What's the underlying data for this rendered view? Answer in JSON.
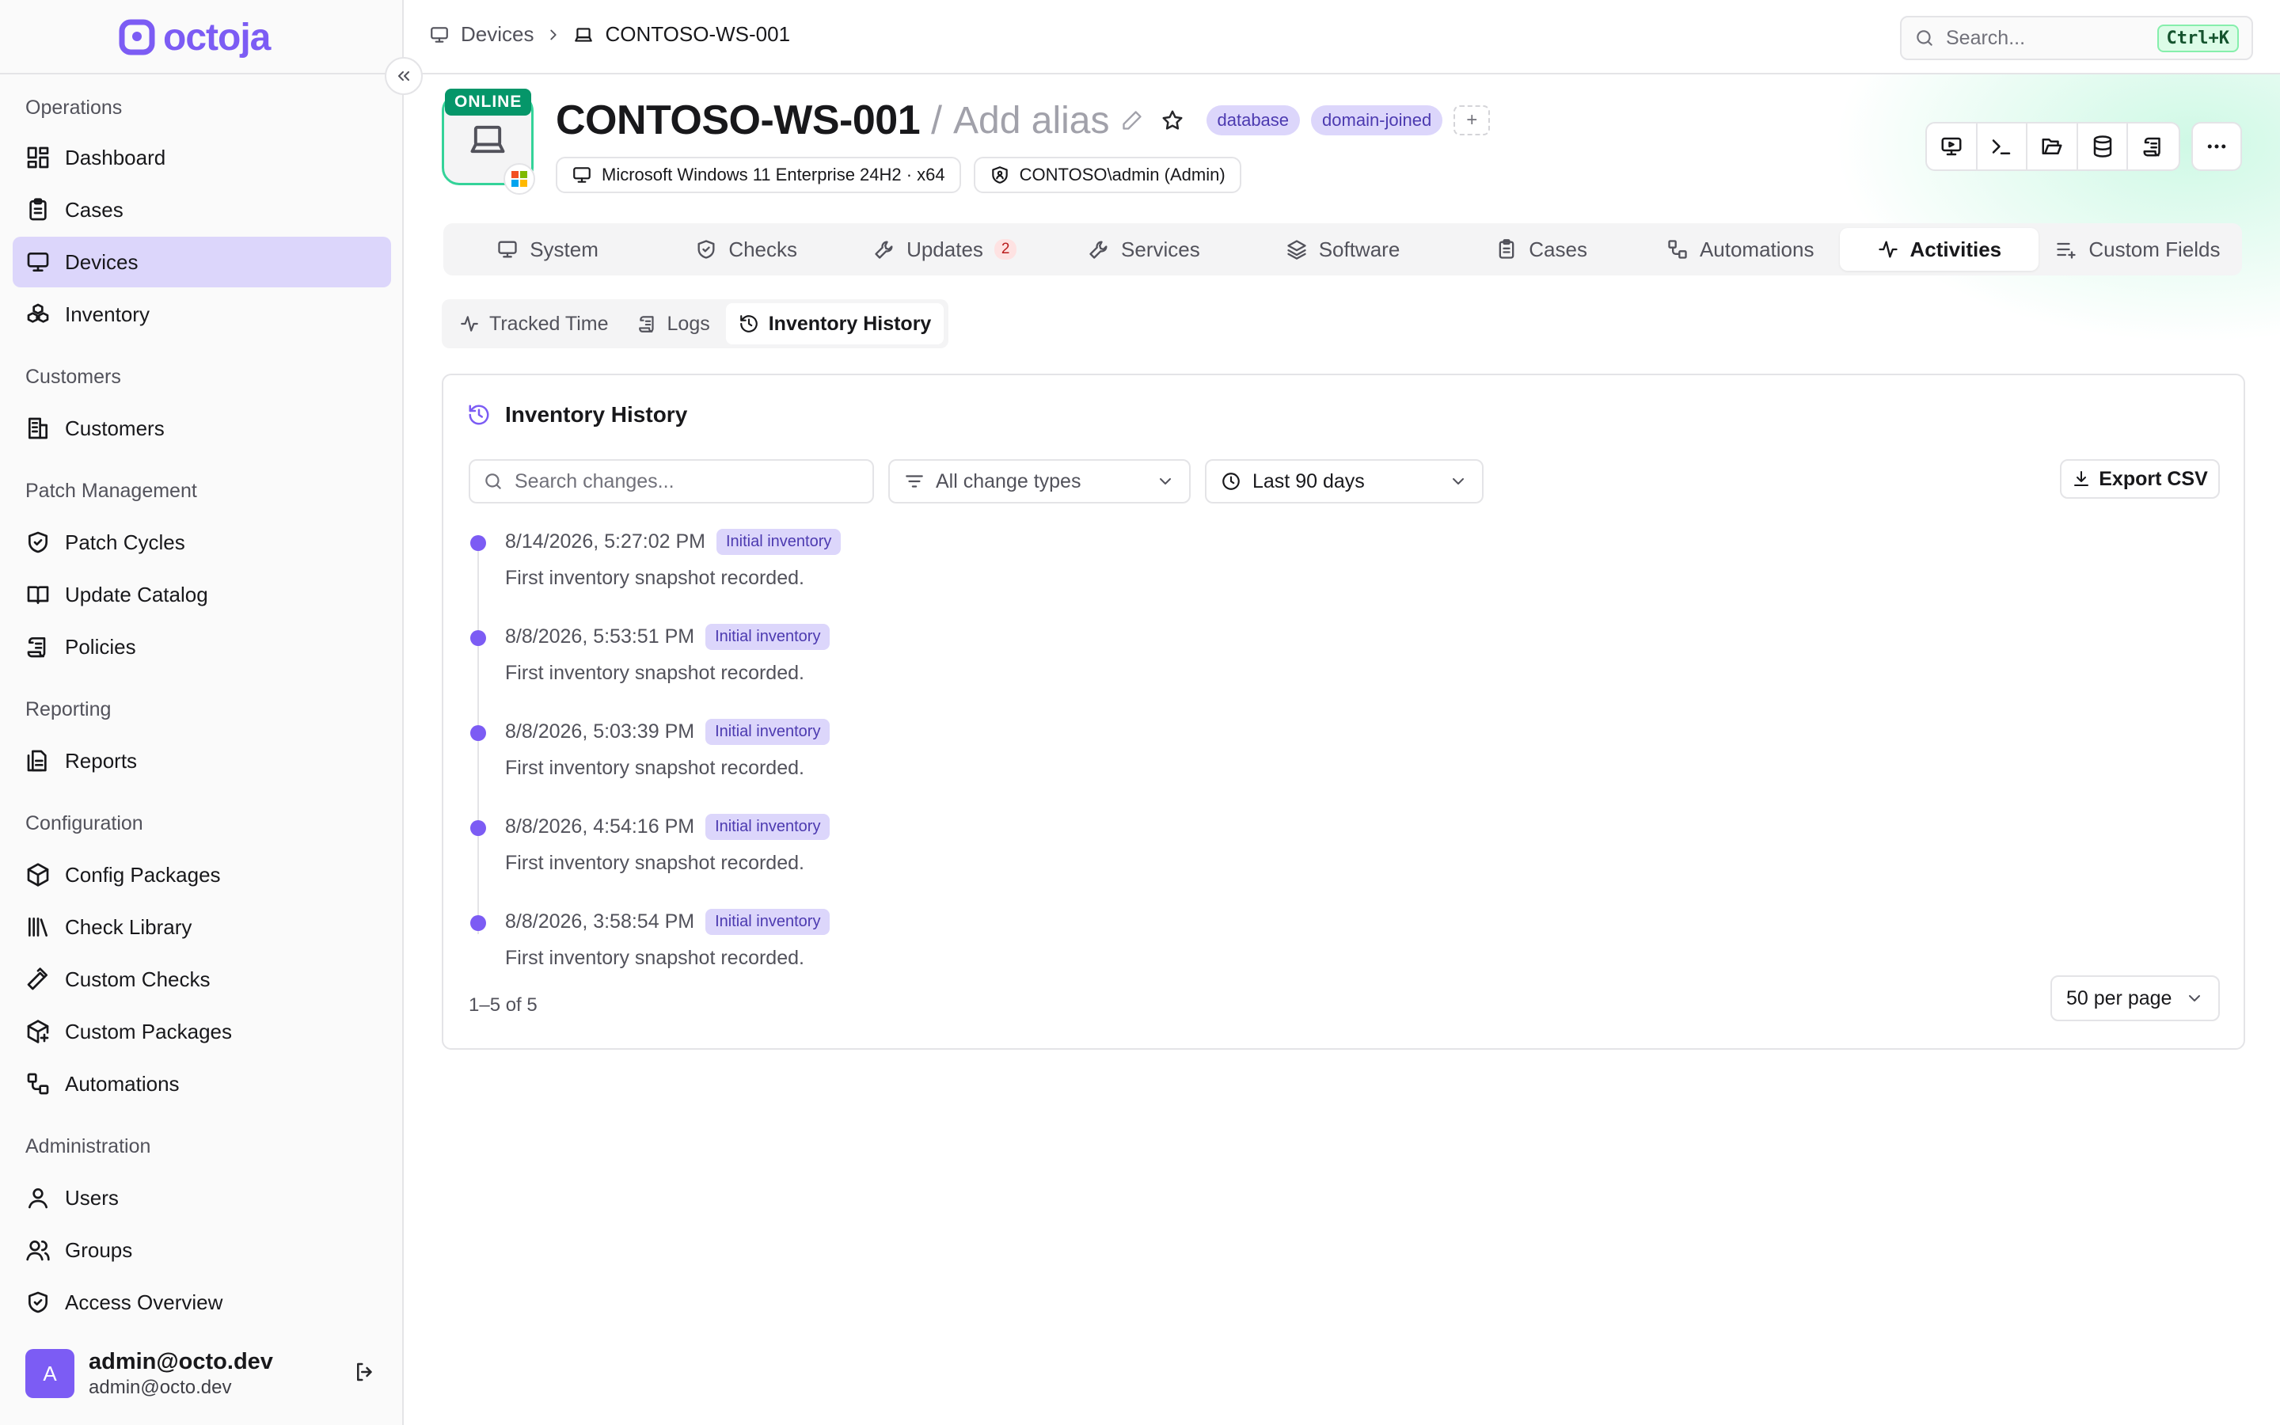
{
  "app": {
    "logo_text": "octoja",
    "brand_color": "#7c5cf4"
  },
  "sidebar": {
    "sections": [
      {
        "title": "Operations",
        "items": [
          {
            "label": "Dashboard",
            "icon": "dashboard-icon"
          },
          {
            "label": "Cases",
            "icon": "clipboard-icon"
          },
          {
            "label": "Devices",
            "icon": "monitor-icon",
            "active": true
          },
          {
            "label": "Inventory",
            "icon": "boxes-icon"
          }
        ]
      },
      {
        "title": "Customers",
        "items": [
          {
            "label": "Customers",
            "icon": "building-icon"
          }
        ]
      },
      {
        "title": "Patch Management",
        "items": [
          {
            "label": "Patch Cycles",
            "icon": "shield-check-icon"
          },
          {
            "label": "Update Catalog",
            "icon": "book-icon"
          },
          {
            "label": "Policies",
            "icon": "scroll-icon"
          }
        ]
      },
      {
        "title": "Reporting",
        "items": [
          {
            "label": "Reports",
            "icon": "report-icon"
          }
        ]
      },
      {
        "title": "Configuration",
        "items": [
          {
            "label": "Config Packages",
            "icon": "package-icon"
          },
          {
            "label": "Check Library",
            "icon": "library-icon"
          },
          {
            "label": "Custom Checks",
            "icon": "hammer-icon"
          },
          {
            "label": "Custom Packages",
            "icon": "package-plus-icon"
          },
          {
            "label": "Automations",
            "icon": "workflow-icon"
          }
        ]
      },
      {
        "title": "Administration",
        "items": [
          {
            "label": "Users",
            "icon": "user-icon"
          },
          {
            "label": "Groups",
            "icon": "users-icon"
          },
          {
            "label": "Access Overview",
            "icon": "shield-icon"
          }
        ]
      }
    ],
    "user": {
      "avatar_letter": "A",
      "name": "admin@octo.dev",
      "email": "admin@octo.dev"
    }
  },
  "breadcrumb": {
    "parent": "Devices",
    "current": "CONTOSO-WS-001"
  },
  "search": {
    "placeholder": "Search...",
    "shortcut": "Ctrl+K"
  },
  "device": {
    "status": "ONLINE",
    "status_color": "#059669",
    "name": "CONTOSO-WS-001",
    "separator": "/",
    "alias_placeholder": "Add alias",
    "tags": [
      "database",
      "domain-joined"
    ],
    "add_tag_label": "+",
    "os": "Microsoft Windows 11 Enterprise 24H2 · x64",
    "user": "CONTOSO\\admin (Admin)"
  },
  "tabs": [
    {
      "label": "System",
      "icon": "monitor-icon"
    },
    {
      "label": "Checks",
      "icon": "shield-check-icon"
    },
    {
      "label": "Updates",
      "icon": "wrench-icon",
      "badge": "2"
    },
    {
      "label": "Services",
      "icon": "wrench-icon"
    },
    {
      "label": "Software",
      "icon": "layers-icon"
    },
    {
      "label": "Cases",
      "icon": "clipboard-icon"
    },
    {
      "label": "Automations",
      "icon": "workflow-icon"
    },
    {
      "label": "Activities",
      "icon": "activity-icon",
      "active": true
    },
    {
      "label": "Custom Fields",
      "icon": "list-plus-icon"
    }
  ],
  "subtabs": [
    {
      "label": "Tracked Time",
      "icon": "activity-icon"
    },
    {
      "label": "Logs",
      "icon": "scroll-icon"
    },
    {
      "label": "Inventory History",
      "icon": "history-icon",
      "active": true
    }
  ],
  "history": {
    "title": "Inventory History",
    "search_placeholder": "Search changes...",
    "type_filter": "All change types",
    "range_filter": "Last 90 days",
    "export_label": "Export CSV",
    "entries": [
      {
        "timestamp": "8/14/2026, 5:27:02 PM",
        "type": "Initial inventory",
        "description": "First inventory snapshot recorded."
      },
      {
        "timestamp": "8/8/2026, 5:53:51 PM",
        "type": "Initial inventory",
        "description": "First inventory snapshot recorded."
      },
      {
        "timestamp": "8/8/2026, 5:03:39 PM",
        "type": "Initial inventory",
        "description": "First inventory snapshot recorded."
      },
      {
        "timestamp": "8/8/2026, 4:54:16 PM",
        "type": "Initial inventory",
        "description": "First inventory snapshot recorded."
      },
      {
        "timestamp": "8/8/2026, 3:58:54 PM",
        "type": "Initial inventory",
        "description": "First inventory snapshot recorded."
      }
    ],
    "pagination_info": "1–5 of 5",
    "per_page": "50 per page"
  }
}
